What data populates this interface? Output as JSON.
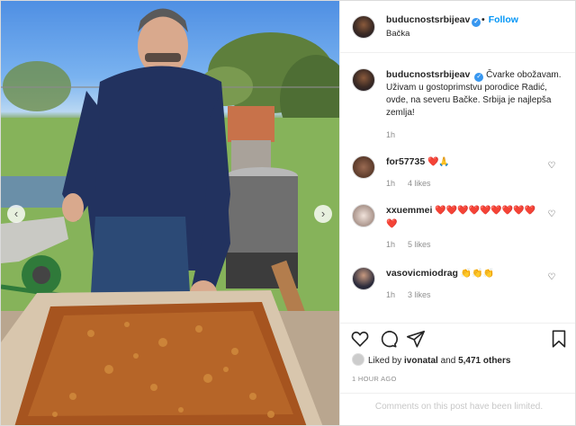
{
  "post": {
    "username": "buducnostsrbijeav",
    "verified_icon": "verified-badge-icon",
    "follow_label": "Follow",
    "follow_separator": "•",
    "location": "Bačka",
    "caption_user": "buducnostsrbijeav",
    "caption_text": "Čvarke obožavam. Uživam u gostoprimstvu porodice Radić, ovde, na severu Bačke. Srbija je najlepša zemlja!",
    "caption_time": "1h",
    "photo_prev": "‹",
    "photo_next": "›"
  },
  "comments": [
    {
      "user": "for57735",
      "text": "❤️🙏",
      "time": "1h",
      "likes": "4 likes"
    },
    {
      "user": "xxuemmei",
      "text": "❤️❤️❤️❤️❤️❤️❤️❤️❤️❤️",
      "time": "1h",
      "likes": "5 likes"
    },
    {
      "user": "vasovicmiodrag",
      "text": "👏👏👏",
      "time": "1h",
      "likes": "3 likes"
    }
  ],
  "footer": {
    "liked_by_prefix": "Liked by",
    "liked_by_user": "ivonatal",
    "liked_by_and": "and",
    "liked_by_count": "5,471 others",
    "time_ago": "1 HOUR AGO",
    "comments_limited": "Comments on this post have been limited."
  },
  "colors": {
    "accent": "#0095f6",
    "muted": "#8e8e8e",
    "verified": "#3897f0"
  }
}
